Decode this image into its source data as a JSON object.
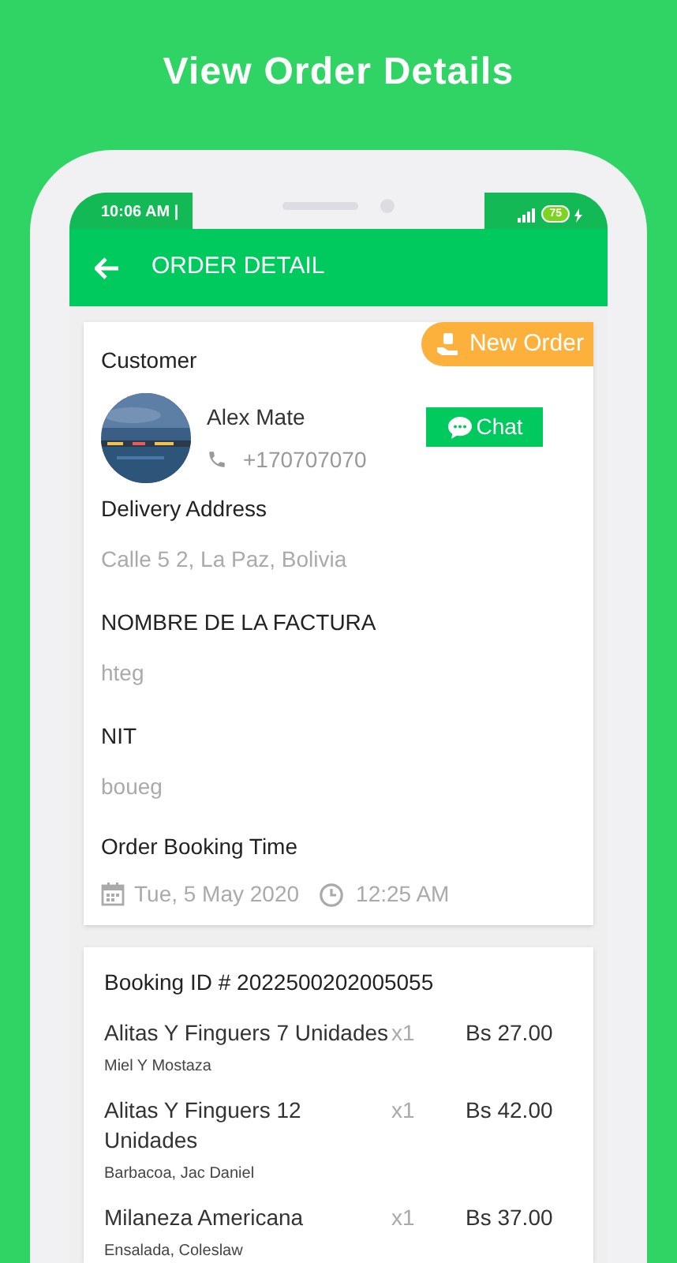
{
  "headline": "View Order Details",
  "status_bar": {
    "time": "10:06 AM |",
    "battery": "75"
  },
  "app_bar": {
    "title": "ORDER DETAIL"
  },
  "order_badge": "New Order",
  "customer": {
    "label": "Customer",
    "name": "Alex Mate",
    "phone": "+170707070",
    "chat_button": "Chat"
  },
  "fields": [
    {
      "label": "Delivery Address",
      "value": "Calle 5 2, La Paz, Bolivia"
    },
    {
      "label": "NOMBRE DE LA FACTURA",
      "value": "hteg"
    },
    {
      "label": "NIT",
      "value": "boueg"
    }
  ],
  "booking_time": {
    "label": "Order Booking Time",
    "date": "Tue, 5 May 2020",
    "time": "12:25 AM"
  },
  "booking": {
    "title": "Booking ID # 2022500202005055",
    "items": [
      {
        "name": "Alitas Y Finguers 7 Unidades",
        "detail": "Miel Y Mostaza",
        "qty": "x1",
        "price": "Bs 27.00"
      },
      {
        "name": "Alitas Y Finguers 12 Unidades",
        "detail": "Barbacoa, Jac Daniel",
        "qty": "x1",
        "price": "Bs 42.00"
      },
      {
        "name": "Milaneza Americana",
        "detail": "Ensalada, Coleslaw",
        "qty": "x1",
        "price": "Bs 37.00"
      }
    ]
  }
}
